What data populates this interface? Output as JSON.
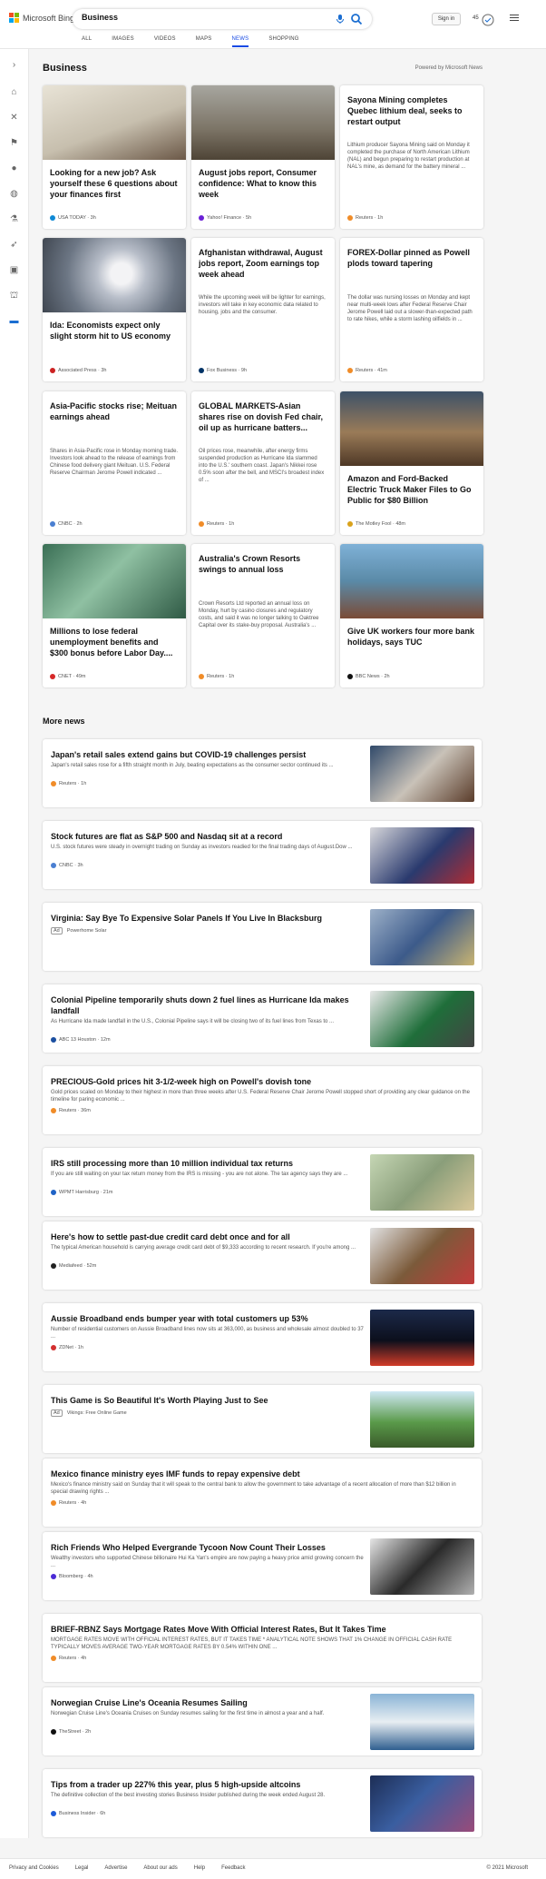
{
  "app": {
    "brand": "Microsoft Bing"
  },
  "search": {
    "query": "Business"
  },
  "tabs": [
    "ALL",
    "IMAGES",
    "VIDEOS",
    "MAPS",
    "NEWS",
    "SHOPPING"
  ],
  "header": {
    "signin": "Sign in",
    "points": "45"
  },
  "section": {
    "title": "Business",
    "powered": "Powered by Microsoft News"
  },
  "cards": [
    {
      "title": "Looking for a new job? Ask yourself these 6 questions about your finances first",
      "desc": "",
      "source": "USA TODAY · 3h",
      "color": "#0f89d5"
    },
    {
      "title": "August jobs report, Consumer confidence: What to know this week",
      "desc": "",
      "source": "Yahoo! Finance · 5h",
      "color": "#6b21d6"
    },
    {
      "title": "Sayona Mining completes Quebec lithium deal, seeks to restart output",
      "desc": "Lithium producer Sayona Mining said on Monday it completed the purchase of North American Lithium (NAL) and begun preparing to restart production at NAL's mine, as demand for the battery mineral ...",
      "source": "Reuters · 1h",
      "color": "#f08c28"
    },
    {
      "title": "Ida: Economists expect only slight storm hit to US economy",
      "desc": "",
      "source": "Associated Press · 3h",
      "color": "#cc2222"
    },
    {
      "title": "Afghanistan withdrawal, August jobs report, Zoom earnings top week ahead",
      "desc": "While the upcoming week will be lighter for earnings, investors will take in key economic data related to housing, jobs and the consumer.",
      "source": "Fox Business · 9h",
      "color": "#003366"
    },
    {
      "title": "FOREX-Dollar pinned as Powell plods toward tapering",
      "desc": "The dollar was nursing losses on Monday and kept near multi-week lows after Federal Reserve Chair Jerome Powell laid out a slower-than-expected path to rate hikes, while a storm lashing oilfields in ...",
      "source": "Reuters · 41m",
      "color": "#f08c28"
    },
    {
      "title": "Asia-Pacific stocks rise; Meituan earnings ahead",
      "desc": "Shares in Asia-Pacific rose in Monday morning trade. Investors look ahead to the release of earnings from Chinese food delivery giant Meituan. U.S. Federal Reserve Chairman Jerome Powell indicated ...",
      "source": "CNBC · 2h",
      "color": "#4a7fd1"
    },
    {
      "title": "GLOBAL MARKETS-Asian shares rise on dovish Fed chair, oil up as hurricane batters...",
      "desc": "Oil prices rose, meanwhile, after energy firms suspended production as Hurricane Ida slammed into the U.S.' southern coast. Japan's Nikkei rose 0.5% soon after the bell, and MSCI's broadest index of ...",
      "source": "Reuters · 1h",
      "color": "#f08c28"
    },
    {
      "title": "Amazon and Ford-Backed Electric Truck Maker Files to Go Public for $80 Billion",
      "desc": "",
      "source": "The Motley Fool · 48m",
      "color": "#d9a21b"
    },
    {
      "title": "Millions to lose federal unemployment benefits and $300 bonus before Labor Day....",
      "desc": "",
      "source": "CNET · 49m",
      "color": "#d62828"
    },
    {
      "title": "Australia's Crown Resorts swings to annual loss",
      "desc": "Crown Resorts Ltd reported an annual loss on Monday, hurt by casino closures and regulatory costs, and said it was no longer talking to Oaktree Capital over its stake-buy proposal. Australia's ...",
      "source": "Reuters · 1h",
      "color": "#f08c28"
    },
    {
      "title": "Give UK workers four more bank holidays, says TUC",
      "desc": "",
      "source": "BBC News · 2h",
      "color": "#111111"
    }
  ],
  "more_news": {
    "title": "More news",
    "items": [
      {
        "title": "Japan's retail sales extend gains but COVID-19 challenges persist",
        "desc": "Japan's retail sales rose for a fifth straight month in July, beating expectations as the consumer sector continued its ...",
        "source": "Reuters · 1h",
        "color": "#f08c28"
      },
      {
        "title": "Stock futures are flat as S&P 500 and Nasdaq sit at a record",
        "desc": "U.S. stock futures were steady in overnight trading on Sunday as investors readied for the final trading days of August.Dow ...",
        "source": "CNBC · 3h",
        "color": "#4a7fd1"
      },
      {
        "title": "Virginia: Say Bye To Expensive Solar Panels If You Live In Blacksburg",
        "desc": "",
        "source": "Powerhome Solar",
        "ad": "Ad",
        "color": ""
      },
      {
        "title": "Colonial Pipeline temporarily shuts down 2 fuel lines as Hurricane Ida makes landfall",
        "desc": "As Hurricane Ida made landfall in the U.S., Colonial Pipeline says it will be closing two of its fuel lines from Texas to ...",
        "source": "ABC 13 Houston · 12m",
        "color": "#1b4fa0"
      },
      {
        "title": "PRECIOUS-Gold prices hit 3-1/2-week high on Powell's dovish tone",
        "desc": "Gold prices scaled on Monday to their highest in more than three weeks after U.S. Federal Reserve Chair Jerome Powell stopped short of providing any clear guidance on the timeline for paring economic ...",
        "source": "Reuters · 36m",
        "color": "#f08c28"
      },
      {
        "title": "IRS still processing more than 10 million individual tax returns",
        "desc": "If you are still waiting on your tax return money from the IRS is missing - you are not alone. The tax agency says they are ...",
        "source": "WPMT Harrisburg · 21m",
        "color": "#1f63c6"
      },
      {
        "title": "Here's how to settle past-due credit card debt once and for all",
        "desc": "The typical American  household is carrying average credit card debt of $9,333 according to recent research. If you're among ...",
        "source": "Mediafeed · 52m",
        "color": "#222222"
      },
      {
        "title": "Aussie Broadband ends bumper year with total customers up 53%",
        "desc": "Number of residential customers on Aussie Broadband lines now sits at 363,000, as business and wholesale almost doubled to 37 ...",
        "source": "ZDNet · 1h",
        "color": "#d32f2f"
      },
      {
        "title": "This Game is So Beautiful It's Worth Playing Just to See",
        "desc": "",
        "source": "Vikings: Free Online Game",
        "ad": "Ad",
        "color": ""
      },
      {
        "title": "Mexico finance ministry eyes IMF funds to repay expensive debt",
        "desc": "Mexico's finance ministry said on Sunday that it will speak to the central bank to allow the government to take advantage of a recent allocation of more than $12 billion in special drawing rights ...",
        "source": "Reuters · 4h",
        "color": "#f08c28"
      },
      {
        "title": "Rich Friends Who Helped Evergrande Tycoon Now Count Their Losses",
        "desc": "Wealthy investors who supported Chinese billionaire Hui Ka Yan's empire are now paying a heavy price amid growing concern the ...",
        "source": "Bloomberg · 4h",
        "color": "#4b2bd6"
      },
      {
        "title": "BRIEF-RBNZ Says Mortgage Rates Move With Official Interest Rates, But It Takes Time",
        "desc": "MORTGAGE RATES MOVE WITH OFFICIAL INTEREST RATES, BUT IT TAKES TIME * ANALYTICAL NOTE SHOWS THAT 1% CHANGE IN OFFICIAL CASH RATE TYPICALLY MOVES AVERAGE TWO-YEAR MORTGAGE RATES BY 0.54% WITHIN ONE ...",
        "source": "Reuters · 4h",
        "color": "#f08c28"
      },
      {
        "title": "Norwegian Cruise Line's Oceania Resumes Sailing",
        "desc": "Norwegian Cruise Line's Oceania Cruises on Sunday resumes sailing for the first time in almost a year and a half.",
        "source": "TheStreet · 2h",
        "color": "#111111"
      },
      {
        "title": "Tips from a trader up 227% this year, plus 5 high-upside altcoins",
        "desc": "The definitive collection of the best investing stories Business Insider published during the week ended August 28.",
        "source": "Business Insider · 6h",
        "color": "#1d5bd8"
      }
    ]
  },
  "footer": {
    "links": [
      "Privacy and Cookies",
      "Legal",
      "Advertise",
      "About our ads",
      "Help",
      "Feedback"
    ],
    "copyright": "© 2021 Microsoft"
  }
}
